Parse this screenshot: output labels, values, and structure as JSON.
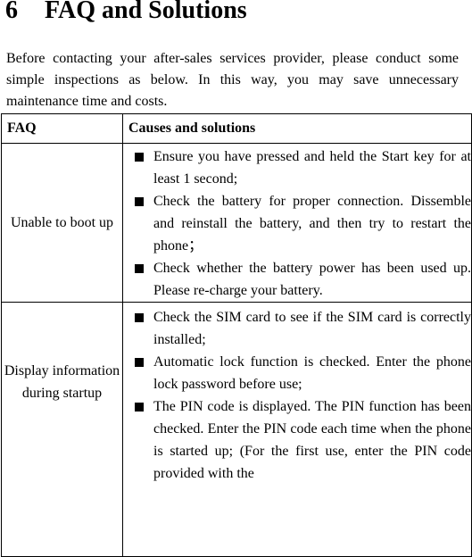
{
  "section": {
    "number": "6",
    "title": "FAQ and Solutions"
  },
  "intro": "Before contacting your after-sales services provider, please conduct some simple inspections as below. In this way, you may save unnecessary maintenance time and costs.",
  "table": {
    "headers": [
      "FAQ",
      "Causes and solutions"
    ],
    "rows": [
      {
        "question": "Unable to boot up",
        "solutions": [
          "Ensure you have pressed and held the Start key for at least 1 second;",
          "Check the battery for proper connection. Dissemble and reinstall the battery, and then try to restart the phone；",
          "Check whether the battery power has been used up. Please re-charge your battery."
        ]
      },
      {
        "question": "Display information during startup",
        "solutions": [
          "Check the SIM card to see if the SIM card is correctly installed;",
          "Automatic lock function is checked. Enter the phone lock password before use;",
          "The PIN code is displayed. The PIN function has been checked. Enter the PIN code each time when the phone is started up; (For the first use, enter the PIN code provided with the"
        ]
      }
    ]
  },
  "icons": {
    "bullet": "black-square-bullet"
  }
}
